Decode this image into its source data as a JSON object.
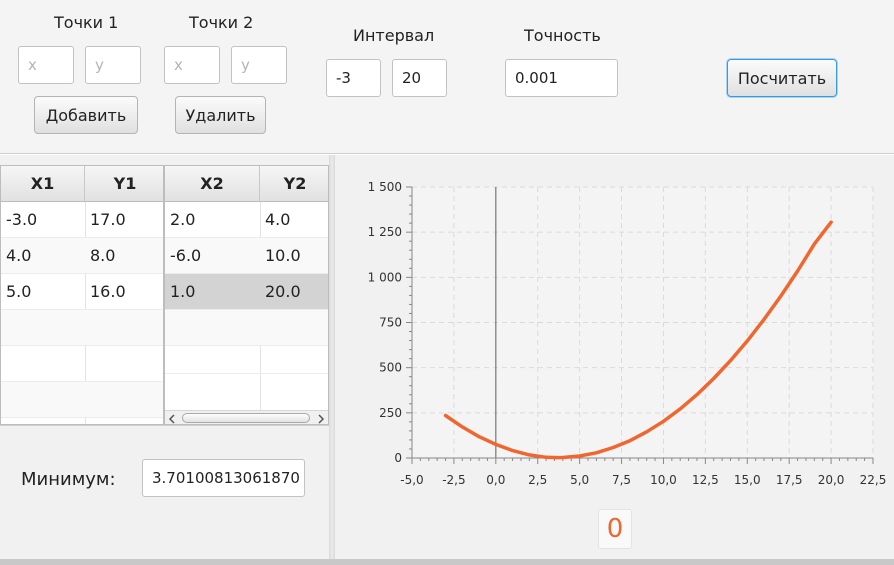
{
  "points1": {
    "label": "Точки 1",
    "x_placeholder": "x",
    "y_placeholder": "y",
    "add_label": "Добавить"
  },
  "points2": {
    "label": "Точки 2",
    "x_placeholder": "x",
    "y_placeholder": "y",
    "remove_label": "Удалить"
  },
  "interval": {
    "label": "Интервал",
    "from": "-3",
    "to": "20"
  },
  "precision": {
    "label": "Точность",
    "value": "0.001"
  },
  "compute_label": "Посчитать",
  "table1": {
    "headers": [
      "X1",
      "Y1"
    ],
    "rows": [
      [
        "-3.0",
        "17.0"
      ],
      [
        "4.0",
        "8.0"
      ],
      [
        "5.0",
        "16.0"
      ]
    ]
  },
  "table2": {
    "headers": [
      "X2",
      "Y2"
    ],
    "rows": [
      [
        "2.0",
        "4.0"
      ],
      [
        "-6.0",
        "10.0"
      ],
      [
        "1.0",
        "20.0"
      ]
    ],
    "selected_row": 2
  },
  "minimum": {
    "label": "Минимум:",
    "value": "3.70100813061870"
  },
  "chart_indicator": "0",
  "colors": {
    "curve": "#f0662f",
    "primary_border": "#3a9ae0",
    "selected_row": "#d3d3d3"
  },
  "chart_data": {
    "type": "line",
    "x_ticks": [
      "-5,0",
      "-2,5",
      "0,0",
      "2,5",
      "5,0",
      "7,5",
      "10,0",
      "12,5",
      "15,0",
      "17,5",
      "20,0",
      "22,5"
    ],
    "y_ticks": [
      "0",
      "250",
      "500",
      "750",
      "1 000",
      "1 250",
      "1 500"
    ],
    "xlim": [
      -5,
      22.5
    ],
    "ylim": [
      0,
      1500
    ],
    "grid": true,
    "series": [
      {
        "x": [
          -3,
          -2,
          -1,
          0,
          1,
          2,
          3,
          3.7,
          4,
          5,
          6,
          7,
          8,
          9,
          10,
          11,
          12,
          13,
          14,
          15,
          16,
          17,
          18,
          19,
          20
        ],
        "y": [
          235,
          172,
          118,
          75,
          41,
          17,
          4,
          2,
          3,
          11,
          29,
          58,
          96,
          145,
          203,
          272,
          351,
          440,
          539,
          648,
          767,
          896,
          1035,
          1184,
          1305
        ]
      }
    ]
  }
}
